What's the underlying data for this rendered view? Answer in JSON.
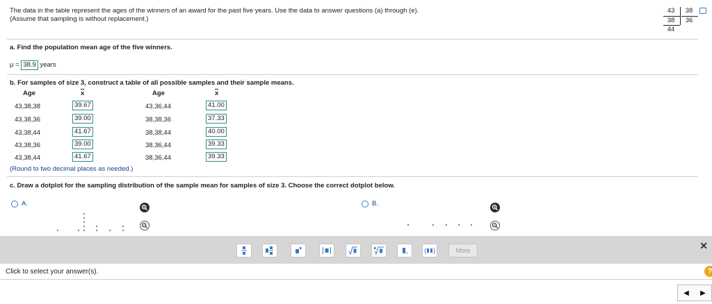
{
  "intro": {
    "line1": "The data in the table represent the ages of the winners of an award for the past five years. Use the data to answer questions (a) through (e).",
    "line2": "(Assume that sampling is without replacement.)"
  },
  "data_table": {
    "values": [
      "43",
      "38",
      "38",
      "36",
      "44"
    ]
  },
  "part_a": {
    "question": "a. Find the population mean age of the five winners.",
    "mu_label": "μ =",
    "answer": "38.9",
    "unit": "years"
  },
  "part_b": {
    "question": "b. For samples of size 3, construct a table of all possible samples and their sample means.",
    "col_age": "Age",
    "col_xbar": "x",
    "left_rows": [
      {
        "age": "43,38,38",
        "mean": "39.67"
      },
      {
        "age": "43,38,36",
        "mean": "39.00"
      },
      {
        "age": "43,38,44",
        "mean": "41.67"
      },
      {
        "age": "43,38,36",
        "mean": "39.00"
      },
      {
        "age": "43,38,44",
        "mean": "41.67"
      }
    ],
    "right_rows": [
      {
        "age": "43,36,44",
        "mean": "41.00"
      },
      {
        "age": "38,38,36",
        "mean": "37.33"
      },
      {
        "age": "38,38,44",
        "mean": "40.00"
      },
      {
        "age": "38,36,44",
        "mean": "39.33"
      },
      {
        "age": "38,36,44",
        "mean": "39.33"
      }
    ],
    "hint": "(Round to two decimal places as needed.)"
  },
  "part_c": {
    "question": "c. Draw a dotplot for the sampling distribution of the sample mean for samples of size 3. Choose the correct dotplot below.",
    "option_a": "A.",
    "option_b": "B."
  },
  "toolbar": {
    "more_label": "More"
  },
  "status": {
    "text": "Click to select your answer(s)."
  },
  "help": {
    "label": "?"
  },
  "colors": {
    "answer_border": "#2e8b8b",
    "link_blue": "#1a3f8a",
    "toolbar_bg": "#d6d6d6",
    "help_orange": "#e8a51d"
  }
}
